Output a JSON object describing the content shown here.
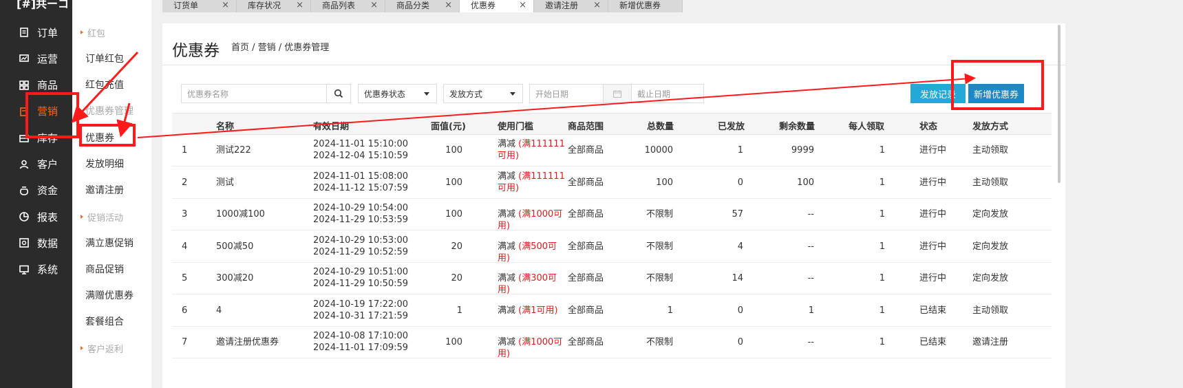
{
  "app": {
    "logo": "[#]共ーコ"
  },
  "left_nav": [
    {
      "label": "订单",
      "icon": "order-icon"
    },
    {
      "label": "运营",
      "icon": "operation-icon"
    },
    {
      "label": "商品",
      "icon": "goods-icon"
    },
    {
      "label": "营销",
      "icon": "marketing-icon",
      "active": true
    },
    {
      "label": "库存",
      "icon": "stock-icon"
    },
    {
      "label": "客户",
      "icon": "customer-icon"
    },
    {
      "label": "资金",
      "icon": "money-icon"
    },
    {
      "label": "报表",
      "icon": "report-icon"
    },
    {
      "label": "数据",
      "icon": "data-icon"
    },
    {
      "label": "系统",
      "icon": "system-icon"
    }
  ],
  "sub_nav": {
    "groups": [
      "红包",
      "优惠券管理",
      "促销活动",
      "客户返利"
    ],
    "items": [
      "订单红包",
      "红包充值",
      "优惠券",
      "发放明细",
      "邀请注册",
      "满立惠促销",
      "商品促销",
      "满赠优惠券",
      "套餐组合"
    ]
  },
  "tabs": [
    {
      "label": "订货单"
    },
    {
      "label": "库存状况"
    },
    {
      "label": "商品列表"
    },
    {
      "label": "商品分类"
    },
    {
      "label": "优惠券",
      "active": true
    },
    {
      "label": "邀请注册"
    },
    {
      "label": "新增优惠券"
    }
  ],
  "tab_close": "×",
  "page": {
    "title": "优惠券",
    "breadcrumb": "首页 / 营销 / 优惠券管理"
  },
  "filters": {
    "name_placeholder": "优惠券名称",
    "status_label": "优惠券状态",
    "method_label": "发放方式",
    "start_placeholder": "开始日期",
    "end_placeholder": "截止日期",
    "issue_record_button": "发放记录",
    "add_coupon_button": "新增优惠券"
  },
  "colors": {
    "accent": "#f36b21",
    "primary": "#1e88c7",
    "secondary": "#23a9d8",
    "annotation": "#ff1a1a"
  },
  "table": {
    "headers": [
      "名称",
      "有效日期",
      "面值(元)",
      "使用门槛",
      "商品范围",
      "总数量",
      "已发放",
      "剩余数量",
      "每人领取",
      "状态",
      "发放方式"
    ],
    "rows": [
      {
        "idx": "1",
        "name": "测试222",
        "start": "2024-11-01 15:10:00",
        "end": "2024-12-04 15:10:59",
        "value": "100",
        "rule": "满减",
        "cond": "(满111111可用)",
        "scope": "全部商品",
        "total": "10000",
        "issued": "1",
        "remain": "9999",
        "per": "1",
        "status": "进行中",
        "method": "主动领取"
      },
      {
        "idx": "2",
        "name": "测试",
        "start": "2024-11-01 15:08:00",
        "end": "2024-11-12 15:07:59",
        "value": "100",
        "rule": "满减",
        "cond": "(满111111可用)",
        "scope": "全部商品",
        "total": "100",
        "issued": "0",
        "remain": "100",
        "per": "1",
        "status": "进行中",
        "method": "主动领取"
      },
      {
        "idx": "3",
        "name": "1000减100",
        "start": "2024-10-29 10:54:00",
        "end": "2024-11-29 10:53:59",
        "value": "100",
        "rule": "满减",
        "cond": "(满1000可用)",
        "scope": "全部商品",
        "total": "不限制",
        "issued": "57",
        "remain": "--",
        "per": "1",
        "status": "进行中",
        "method": "定向发放"
      },
      {
        "idx": "4",
        "name": "500减50",
        "start": "2024-10-29 10:53:00",
        "end": "2024-11-29 10:52:59",
        "value": "20",
        "rule": "满减",
        "cond": "(满500可用)",
        "scope": "全部商品",
        "total": "不限制",
        "issued": "4",
        "remain": "--",
        "per": "1",
        "status": "进行中",
        "method": "定向发放"
      },
      {
        "idx": "5",
        "name": "300减20",
        "start": "2024-10-29 10:51:00",
        "end": "2024-11-29 10:50:59",
        "value": "20",
        "rule": "满减",
        "cond": "(满300可用)",
        "scope": "全部商品",
        "total": "不限制",
        "issued": "14",
        "remain": "--",
        "per": "1",
        "status": "进行中",
        "method": "定向发放"
      },
      {
        "idx": "6",
        "name": "4",
        "start": "2024-10-19 17:22:00",
        "end": "2024-10-31 17:21:59",
        "value": "1",
        "rule": "满减",
        "cond": "(满1可用)",
        "scope": "全部商品",
        "total": "1",
        "issued": "0",
        "remain": "1",
        "per": "1",
        "status": "已结束",
        "method": "主动领取"
      },
      {
        "idx": "7",
        "name": "邀请注册优惠券",
        "start": "2024-10-08 17:10:00",
        "end": "2024-11-01 17:09:59",
        "value": "100",
        "rule": "满减",
        "cond": "(满1000可用)",
        "scope": "全部商品",
        "total": "不限制",
        "issued": "0",
        "remain": "--",
        "per": "1",
        "status": "已结束",
        "method": "邀请注册"
      }
    ]
  }
}
